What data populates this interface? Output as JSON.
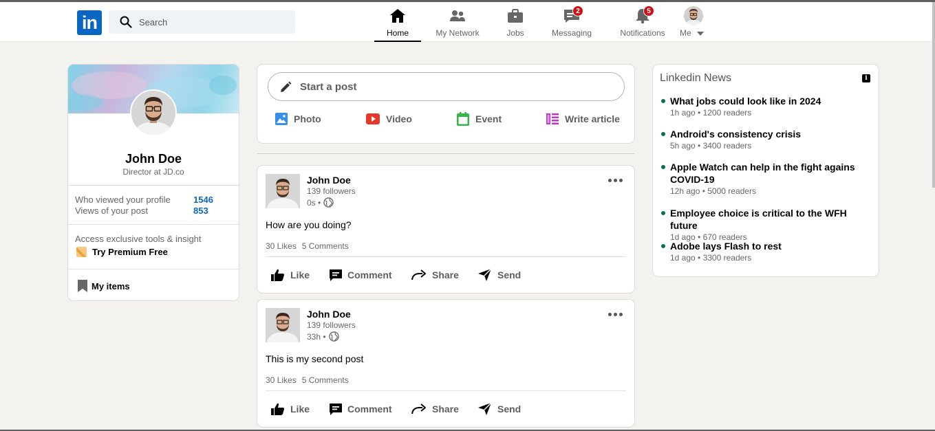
{
  "header": {
    "logo_text": "in",
    "search_placeholder": "Search",
    "nav": [
      {
        "label": "Home",
        "icon": "home-icon",
        "active": true
      },
      {
        "label": "My Network",
        "icon": "network-icon"
      },
      {
        "label": "Jobs",
        "icon": "briefcase-icon"
      },
      {
        "label": "Messaging",
        "icon": "messaging-icon",
        "badge": "2"
      },
      {
        "label": "Notifications",
        "icon": "bell-icon",
        "badge": "5"
      },
      {
        "label": "Me",
        "icon": "avatar"
      }
    ]
  },
  "profile": {
    "name": "John Doe",
    "title": "Director at JD.co",
    "stats": [
      {
        "label": "Who viewed your profile",
        "value": "1546"
      },
      {
        "label": "Views of your post",
        "value": "853"
      }
    ],
    "promo_text": "Access exclusive tools & insight",
    "premium_label": "Try Premium Free",
    "my_items_label": "My items"
  },
  "composer": {
    "placeholder": "Start a post",
    "actions": [
      {
        "label": "Photo",
        "icon": "photo-icon",
        "color": "#378fe9"
      },
      {
        "label": "Video",
        "icon": "video-icon",
        "color": "#e7372b"
      },
      {
        "label": "Event",
        "icon": "event-icon",
        "color": "#36b44a"
      },
      {
        "label": "Write article",
        "icon": "article-icon",
        "color": "#c037c6"
      }
    ]
  },
  "posts": [
    {
      "author": "John Doe",
      "followers": "139 followers",
      "time": "0s •",
      "text": "How are you doing?",
      "likes": "30 Likes",
      "comments": "5 Comments"
    },
    {
      "author": "John Doe",
      "followers": "139 followers",
      "time": "33h •",
      "text": "This is my second post",
      "likes": "30 Likes",
      "comments": "5 Comments"
    }
  ],
  "post_actions": [
    "Like",
    "Comment",
    "Share",
    "Send"
  ],
  "news": {
    "title": "Linkedin News",
    "info_icon": "i",
    "items": [
      {
        "headline": "What jobs could look like in 2024",
        "meta": "1h ago • 1200 readers"
      },
      {
        "headline": "Android's consistency crisis",
        "meta": "5h ago • 3400 readers"
      },
      {
        "headline": "Apple Watch can help in the fight agains COVID-19",
        "meta": "12h ago • 5000 readers"
      },
      {
        "headline": "Employee choice is critical to the WFH future",
        "meta": "1d ago • 670 readers"
      },
      {
        "headline": "Adobe lays Flash to rest",
        "meta": "1d ago • 3300 readers"
      }
    ]
  },
  "colors": {
    "brand": "#0a66c2",
    "badge": "#cc1016",
    "news_dot": "#057642"
  }
}
